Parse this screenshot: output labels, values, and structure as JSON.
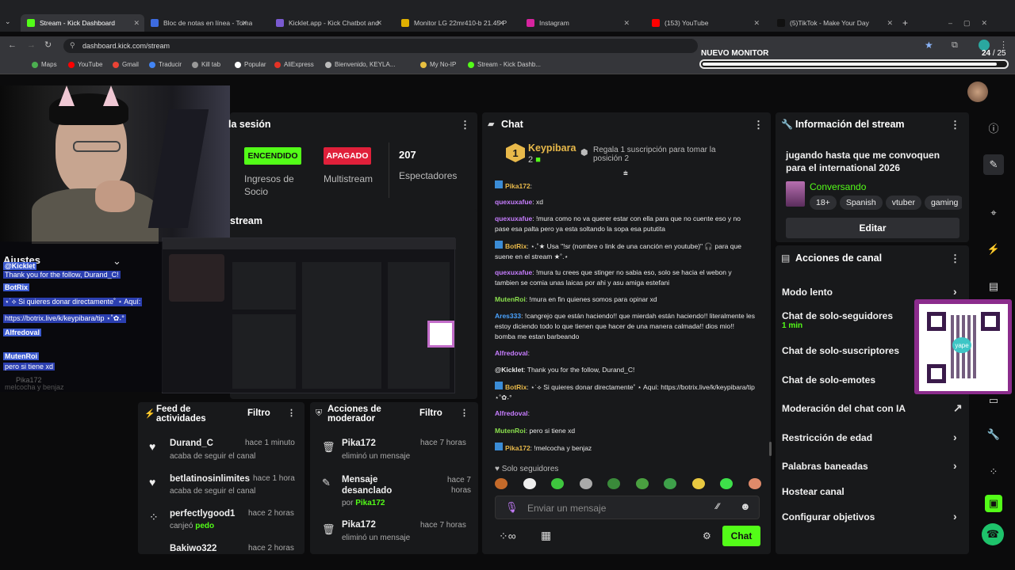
{
  "browser": {
    "tabs": [
      {
        "title": "Stream - Kick Dashboard",
        "color": "#53fc18"
      },
      {
        "title": "Bloc de notas en línea - Toma y",
        "color": "#3d6be0"
      },
      {
        "title": "Kicklet.app - Kick Chatbot and",
        "color": "#7a5ad0"
      },
      {
        "title": "Monitor LG 22mr410-b 21.45 P",
        "color": "#e0b000"
      },
      {
        "title": "Instagram",
        "color": "#d6249f"
      },
      {
        "title": "(153) YouTube",
        "color": "#ff0000"
      },
      {
        "title": "(5)TikTok - Make Your Day",
        "color": "#111"
      }
    ],
    "url": "dashboard.kick.com/stream",
    "bookmarks": [
      "Maps",
      "YouTube",
      "Gmail",
      "Traducir",
      "Kill tab",
      "Popular",
      "AliExpress",
      "Bienvenido, KEYLA...",
      "My No-IP",
      "Stream - Kick Dashb..."
    ]
  },
  "overlay": {
    "monitor_label": "NUEVO MONITOR",
    "counter": "24",
    "counter_total": "/ 25"
  },
  "session": {
    "title": "la sesión",
    "on_badge": "ENCENDIDO",
    "on_label": "Ingresos de Socio",
    "off_badge": "APAGADO",
    "off_label": "Multistream",
    "viewers": "207",
    "viewers_label": "Espectadores",
    "stream_label": "stream"
  },
  "overlay_chat": [
    {
      "user": "@Kicklet",
      "msg": "Thank you for the follow, Durand_C!"
    },
    {
      "user": "BotRix",
      "msg": "⋆˙⟡ Si quieres donar directamente˚ ⋆ Aquí:"
    },
    {
      "user": "",
      "msg": "https://botrix.live/k/keypibara/tip ⋆˚✿˖°"
    },
    {
      "user": "Alfredoval",
      "msg": ""
    },
    {
      "user": "MutenRoi",
      "msg": "pero si tiene xd"
    },
    {
      "user": "Pika172",
      "msg": "melcocha y benjaz"
    }
  ],
  "overlay_heading": "Ajustes",
  "feed": {
    "title": "Feed de actividades",
    "filter": "Filtro",
    "items": [
      {
        "name": "Durand_C",
        "time": "hace 1 minuto",
        "sub": "acaba de seguir el canal"
      },
      {
        "name": "betlatinosinlimites",
        "time": "hace 1 hora",
        "sub": "acaba de seguir el canal"
      },
      {
        "name": "perfectlygood1",
        "time": "hace 2 horas",
        "sub": "canjeó",
        "hl": "pedo"
      },
      {
        "name": "Bakiwo322",
        "time": "hace 2 horas",
        "sub": ""
      }
    ]
  },
  "mod": {
    "title": "Acciones de moderador",
    "filter": "Filtro",
    "items": [
      {
        "name": "Pika172",
        "time": "hace 7 horas",
        "sub": "eliminó un mensaje"
      },
      {
        "name": "Mensaje desanclado",
        "time": "hace 7 horas",
        "sub": "por",
        "hl": "Pika172"
      },
      {
        "name": "Pika172",
        "time": "hace 7 horas",
        "sub": "eliminó un mensaje"
      }
    ]
  },
  "chat": {
    "title": "Chat",
    "gifter": "Keypibara",
    "gifter_count": "2",
    "gift_text": "Regala 1 suscripción para tomar la posición 2",
    "messages": [
      {
        "user": "Pika172",
        "color": "#e8b94a",
        "msg": ""
      },
      {
        "user": "quexuxafue",
        "color": "#c77dff",
        "msg": "xd"
      },
      {
        "user": "quexuxafue",
        "color": "#c77dff",
        "msg": "!mura como no va querer estar con ella para que no cuente eso y no pase esa palta pero ya esta soltando la sopa esa pututita"
      },
      {
        "user": "BotRix",
        "color": "#e8b94a",
        "msg": "⋆.˚★ Usa \"!sr (nombre o link de una canción en youtube)\" 🎧 para que suene en el stream ★˚.⋆"
      },
      {
        "user": "quexuxafue",
        "color": "#c77dff",
        "msg": "!mura tu crees que stinger no sabia eso, solo se hacia el webon y tambien se comia unas laicas por ahi y asu amiga estefani"
      },
      {
        "user": "MutenRoi",
        "color": "#8be04e",
        "msg": "!mura en fin quienes somos para opinar xd"
      },
      {
        "user": "Ares333",
        "color": "#4aa3ff",
        "msg": "!cangrejo que están haciendo!! que mierdah están haciendo!! literalmente les estoy diciendo todo lo que tienen que hacer de una manera calmada!! dios mio!! bomba me estan barbeando"
      },
      {
        "user": "Alfredoval",
        "color": "#c77dff",
        "msg": ""
      },
      {
        "user": "@Kicklet",
        "color": "#e8e8e8",
        "msg": "Thank you for the follow, Durand_C!"
      },
      {
        "user": "BotRix",
        "color": "#e8b94a",
        "msg": "⋆˙⟡ Si quieres donar directamente˚ ⋆ Aquí: https://botrix.live/k/keypibara/tip ⋆˚✿˖°"
      },
      {
        "user": "Alfredoval",
        "color": "#c77dff",
        "msg": ""
      },
      {
        "user": "MutenRoi",
        "color": "#8be04e",
        "msg": "pero si tiene xd"
      },
      {
        "user": "Pika172",
        "color": "#e8b94a",
        "msg": "!melcocha y benjaz"
      }
    ],
    "followers_only": "Solo seguidores",
    "placeholder": "Enviar un mensaje",
    "send": "Chat"
  },
  "info": {
    "title": "Información del stream",
    "stream_title": "jugando hasta que me convoquen para el international 2026",
    "category": "Conversando",
    "tags": [
      "18+",
      "Spanish",
      "vtuber",
      "gaming"
    ],
    "edit": "Editar"
  },
  "actions": {
    "title": "Acciones de canal",
    "items": [
      {
        "label": "Modo lento",
        "sub": "",
        "arrow": "›"
      },
      {
        "label": "Chat de solo-seguidores",
        "sub": "1 min",
        "arrow": ""
      },
      {
        "label": "Chat de solo-suscriptores",
        "sub": "",
        "arrow": ""
      },
      {
        "label": "Chat de solo-emotes",
        "sub": "",
        "arrow": ""
      },
      {
        "label": "Moderación del chat con IA",
        "sub": "",
        "arrow": "↗"
      },
      {
        "label": "Restricción de edad",
        "sub": "",
        "arrow": "›"
      },
      {
        "label": "Palabras baneadas",
        "sub": "",
        "arrow": "›"
      },
      {
        "label": "Hostear canal",
        "sub": "",
        "arrow": ""
      },
      {
        "label": "Configurar objetivos",
        "sub": "",
        "arrow": "›"
      }
    ]
  },
  "qr": {
    "caption": "yape"
  },
  "colors": {
    "kick_green": "#53fc18",
    "panel": "#18191b",
    "bg": "#0b0b0c",
    "red": "#e0203a"
  }
}
